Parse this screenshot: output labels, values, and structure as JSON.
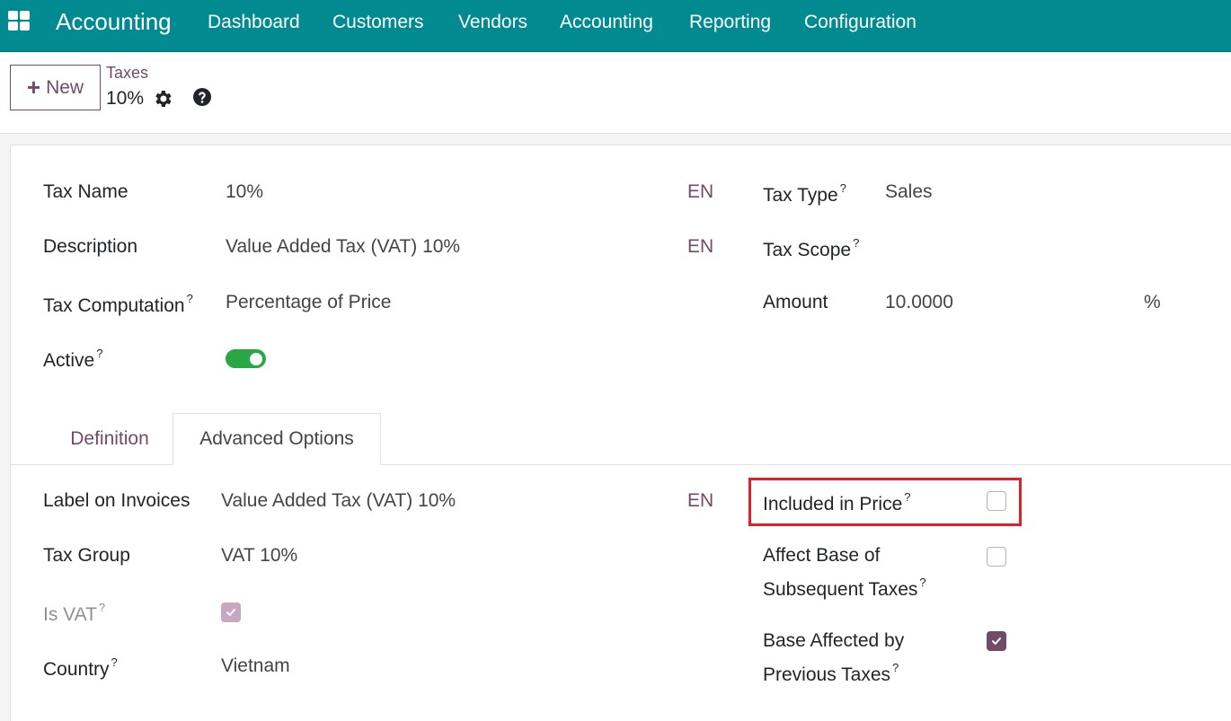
{
  "navbar": {
    "app_name": "Accounting",
    "menu": [
      "Dashboard",
      "Customers",
      "Vendors",
      "Accounting",
      "Reporting",
      "Configuration"
    ],
    "background": "#018a8f"
  },
  "control_panel": {
    "new_label": "New",
    "breadcrumb": "Taxes",
    "record_name": "10%"
  },
  "form": {
    "tax_name": {
      "label": "Tax Name",
      "value": "10%",
      "lang": "EN"
    },
    "description": {
      "label": "Description",
      "value": "Value Added Tax (VAT) 10%",
      "lang": "EN"
    },
    "tax_computation": {
      "label": "Tax Computation",
      "value": "Percentage of Price"
    },
    "active": {
      "label": "Active",
      "value": true
    },
    "tax_type": {
      "label": "Tax Type",
      "value": "Sales"
    },
    "tax_scope": {
      "label": "Tax Scope",
      "value": ""
    },
    "amount": {
      "label": "Amount",
      "value": "10.0000",
      "unit": "%"
    }
  },
  "tabs": {
    "definition": "Definition",
    "advanced": "Advanced Options",
    "active": "advanced"
  },
  "advanced": {
    "label_on_invoices": {
      "label": "Label on Invoices",
      "value": "Value Added Tax (VAT) 10%",
      "lang": "EN"
    },
    "tax_group": {
      "label": "Tax Group",
      "value": "VAT 10%"
    },
    "is_vat": {
      "label": "Is VAT",
      "checked": true
    },
    "country": {
      "label": "Country",
      "value": "Vietnam"
    },
    "included_in_price": {
      "label": "Included in Price",
      "checked": false
    },
    "affect_base": {
      "label_line1": "Affect Base of",
      "label_line2": "Subsequent Taxes",
      "checked": false
    },
    "base_affected": {
      "label_line1": "Base Affected by",
      "label_line2": "Previous Taxes",
      "checked": true
    }
  },
  "help_marker": "?",
  "colors": {
    "primary": "#714b67",
    "toggle_on": "#28a745",
    "highlight": "#e01f26"
  }
}
